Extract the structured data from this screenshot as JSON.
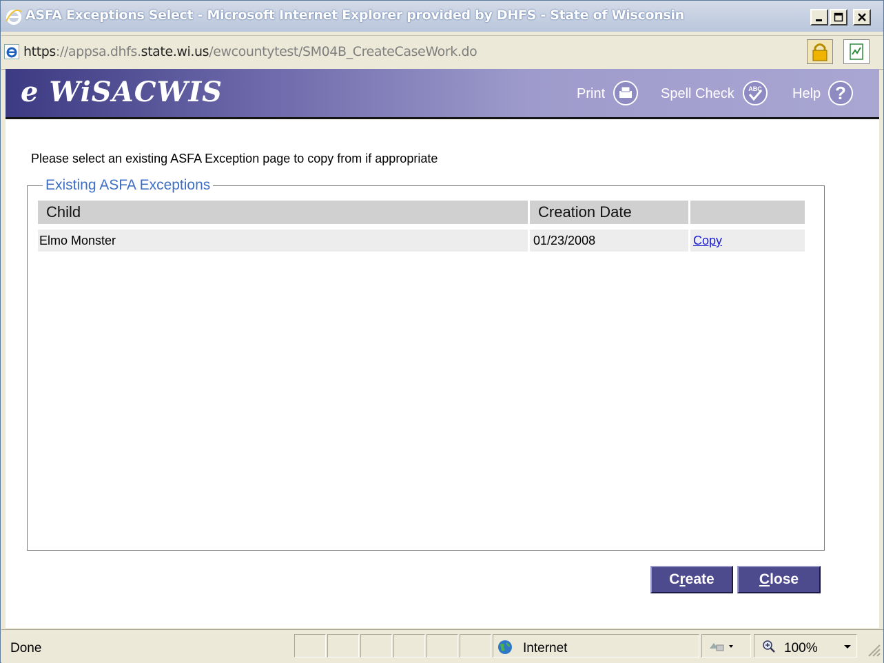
{
  "window": {
    "title": "ASFA Exceptions Select - Microsoft Internet Explorer provided by DHFS - State of Wisconsin",
    "minimize_label": "_",
    "maximize_label": "□",
    "close_label": "✕"
  },
  "address": {
    "scheme": "https",
    "sep": "://",
    "host_prefix": "appsa.dhfs.",
    "host_domain": "state.wi.us",
    "path": "/ewcountytest/SM04B_CreateCaseWork.do"
  },
  "header": {
    "logo": "e WiSACWIS",
    "print_label": "Print",
    "spell_check_label": "Spell Check",
    "help_label": "Help",
    "icons": {
      "print": "printer-icon",
      "spell_check": "abc-check-icon",
      "help": "question-icon"
    }
  },
  "content": {
    "instruction": "Please select an existing ASFA Exception page to copy from if appropriate",
    "fieldset_legend": "Existing ASFA Exceptions",
    "columns": [
      "Child",
      "Creation Date",
      ""
    ],
    "rows": [
      {
        "child": "Elmo Monster",
        "creation_date": "01/23/2008",
        "action": "Copy"
      }
    ]
  },
  "buttons": {
    "create_pre": "C",
    "create_ul": "r",
    "create_post": "eate",
    "close_ul": "C",
    "close_post": "lose"
  },
  "statusbar": {
    "status": "Done",
    "zone": "Internet",
    "zoom": "100%"
  },
  "colors": {
    "banner_start": "#3c3a82",
    "banner_end": "#a9a6d2",
    "legend": "#3f6fc4",
    "button": "#4e4a8e",
    "link": "#1b1bd0"
  }
}
